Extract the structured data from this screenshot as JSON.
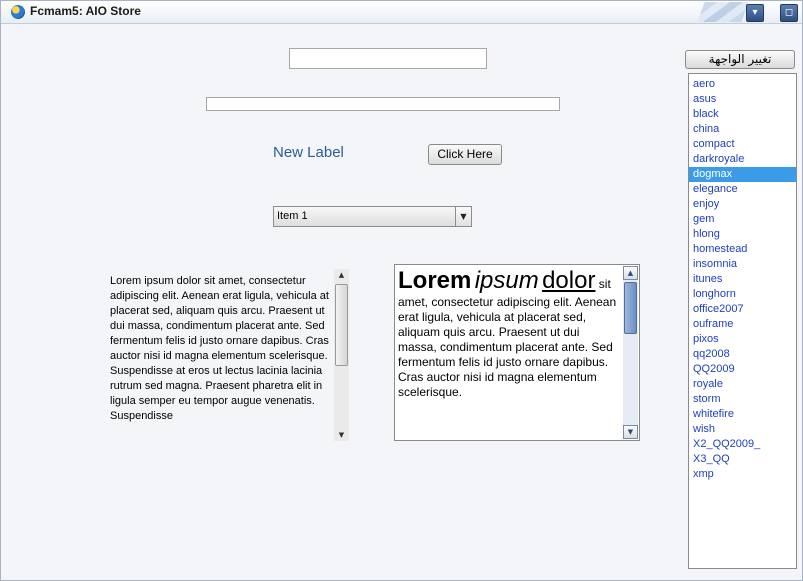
{
  "window": {
    "title": "Fcmam5: AIO Store"
  },
  "form": {
    "text_input_value": "",
    "progress": 0,
    "label": "New Label",
    "button_label": "Click Here",
    "combo_value": "Item 1"
  },
  "plain_text": {
    "content": "Lorem ipsum dolor sit amet, consectetur adipiscing elit. Aenean erat ligula, vehicula at placerat sed, aliquam quis arcu. Praesent ut dui massa, condimentum placerat ante. Sed fermentum felis id justo ornare dapibus. Cras auctor nisi id magna elementum scelerisque. Suspendisse at eros ut lectus lacinia lacinia rutrum sed magna. Praesent pharetra elit in ligula semper eu tempor augue venenatis. Suspendisse"
  },
  "rich_text": {
    "word1": "Lorem",
    "word2": "ipsum",
    "word3": "dolor",
    "rest": " sit amet, consectetur adipiscing elit. Aenean erat ligula, vehicula at placerat sed, aliquam quis arcu. Praesent ut dui massa, condimentum placerat ante. Sed fermentum felis id justo ornare dapibus. Cras auctor nisi id magna elementum scelerisque."
  },
  "theme_panel": {
    "button_label": "تغيير الواجهة",
    "selected": "dogmax",
    "items": [
      "aero",
      "asus",
      "black",
      "china",
      "compact",
      "darkroyale",
      "dogmax",
      "elegance",
      "enjoy",
      "gem",
      "hlong",
      "homestead",
      "insomnia",
      "itunes",
      "longhorn",
      "office2007",
      "ouframe",
      "pixos",
      "qq2008",
      "QQ2009",
      "royale",
      "storm",
      "whitefire",
      "wish",
      "X2_QQ2009_",
      "X3_QQ",
      "xmp"
    ]
  },
  "colors": {
    "accent": "#3a9ce8",
    "link": "#1f3fbf",
    "label": "#2a5c9a"
  }
}
